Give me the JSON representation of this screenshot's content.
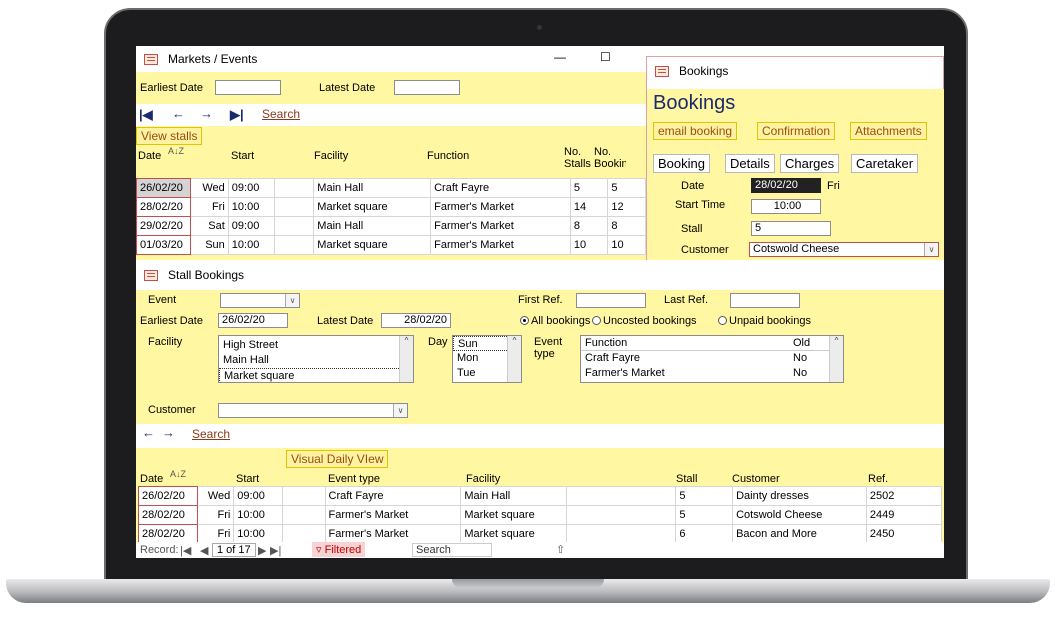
{
  "markets_window": {
    "title": "Markets / Events",
    "minimize_glyph": "—",
    "maximize_glyph": "☐",
    "earliest_date_label": "Earliest Date",
    "earliest_date_value": "",
    "latest_date_label": "Latest Date",
    "latest_date_value": "",
    "nav": {
      "first": "|◀",
      "prev": "←",
      "next": "→",
      "last": "▶|"
    },
    "search_link": "Search",
    "view_stalls_button": "View stalls",
    "sort_icon_glyph": "A↓Z",
    "headers": {
      "date": "Date",
      "start": "Start",
      "facility": "Facility",
      "function": "Function",
      "stalls": "No. Stalls",
      "bookings": "No. Booking"
    },
    "rows": [
      {
        "date": "26/02/20",
        "day": "Wed",
        "start": "09:00",
        "facility": "Main Hall",
        "function": "Craft Fayre",
        "stalls": "5",
        "bookings": "5"
      },
      {
        "date": "28/02/20",
        "day": "Fri",
        "start": "10:00",
        "facility": "Market square",
        "function": "Farmer's Market",
        "stalls": "14",
        "bookings": "12"
      },
      {
        "date": "29/02/20",
        "day": "Sat",
        "start": "09:00",
        "facility": "Main Hall",
        "function": "Farmer's Market",
        "stalls": "8",
        "bookings": "8"
      },
      {
        "date": "01/03/20",
        "day": "Sun",
        "start": "10:00",
        "facility": "Market square",
        "function": "Farmer's Market",
        "stalls": "10",
        "bookings": "10"
      }
    ]
  },
  "bookings_window": {
    "title": "Bookings",
    "heading": "Bookings",
    "buttons": [
      "email booking",
      "Confirmation",
      "Attachments"
    ],
    "tabs": [
      "Booking",
      "Details",
      "Charges",
      "Caretaker"
    ],
    "date_label": "Date",
    "date_value": "28/02/20",
    "day_value": "Fri",
    "start_time_label": "Start Time",
    "start_time_value": "10:00",
    "stall_label": "Stall",
    "stall_value": "5",
    "customer_label": "Customer",
    "customer_value": "Cotswold Cheese"
  },
  "stall_bookings_window": {
    "title": "Stall Bookings",
    "event_label": "Event",
    "event_value": "",
    "first_ref_label": "First Ref.",
    "first_ref_value": "",
    "last_ref_label": "Last Ref.",
    "last_ref_value": "",
    "earliest_date_label": "Earliest Date",
    "earliest_date_value": "26/02/20",
    "latest_date_label": "Latest Date",
    "latest_date_value": "28/02/20",
    "radio_options": [
      "All bookings",
      "Uncosted bookings",
      "Unpaid bookings"
    ],
    "facility_label": "Facility",
    "facility_items": [
      "High Street",
      "Main Hall",
      "Market square"
    ],
    "day_label": "Day",
    "day_items": [
      "Sun",
      "Mon",
      "Tue"
    ],
    "event_type_label": "Event type",
    "event_type_headers": {
      "function": "Function",
      "old": "Old"
    },
    "event_type_items": [
      {
        "function": "Craft Fayre",
        "old": "No"
      },
      {
        "function": "Farmer's Market",
        "old": "No"
      }
    ],
    "customer_label": "Customer",
    "customer_value": "",
    "nav": {
      "prev": "←",
      "next": "→"
    },
    "search_link": "Search",
    "visual_daily_view_button": "Visual Daily VIew",
    "headers": {
      "date": "Date",
      "start": "Start",
      "event_type": "Event type",
      "facility": "Facility",
      "stall": "Stall",
      "customer": "Customer",
      "ref": "Ref."
    },
    "rows": [
      {
        "date": "26/02/20",
        "day": "Wed",
        "start": "09:00",
        "event_type": "Craft Fayre",
        "facility": "Main Hall",
        "stall": "5",
        "customer": "Dainty dresses",
        "ref": "2502"
      },
      {
        "date": "28/02/20",
        "day": "Fri",
        "start": "10:00",
        "event_type": "Farmer's Market",
        "facility": "Market square",
        "stall": "5",
        "customer": "Cotswold Cheese",
        "ref": "2449"
      },
      {
        "date": "28/02/20",
        "day": "Fri",
        "start": "10:00",
        "event_type": "Farmer's Market",
        "facility": "Market square",
        "stall": "6",
        "customer": "Bacon and More",
        "ref": "2450"
      }
    ],
    "record_label": "Record:",
    "record_position": "1 of 17",
    "filtered_label": "Filtered",
    "search_box": "Search"
  }
}
